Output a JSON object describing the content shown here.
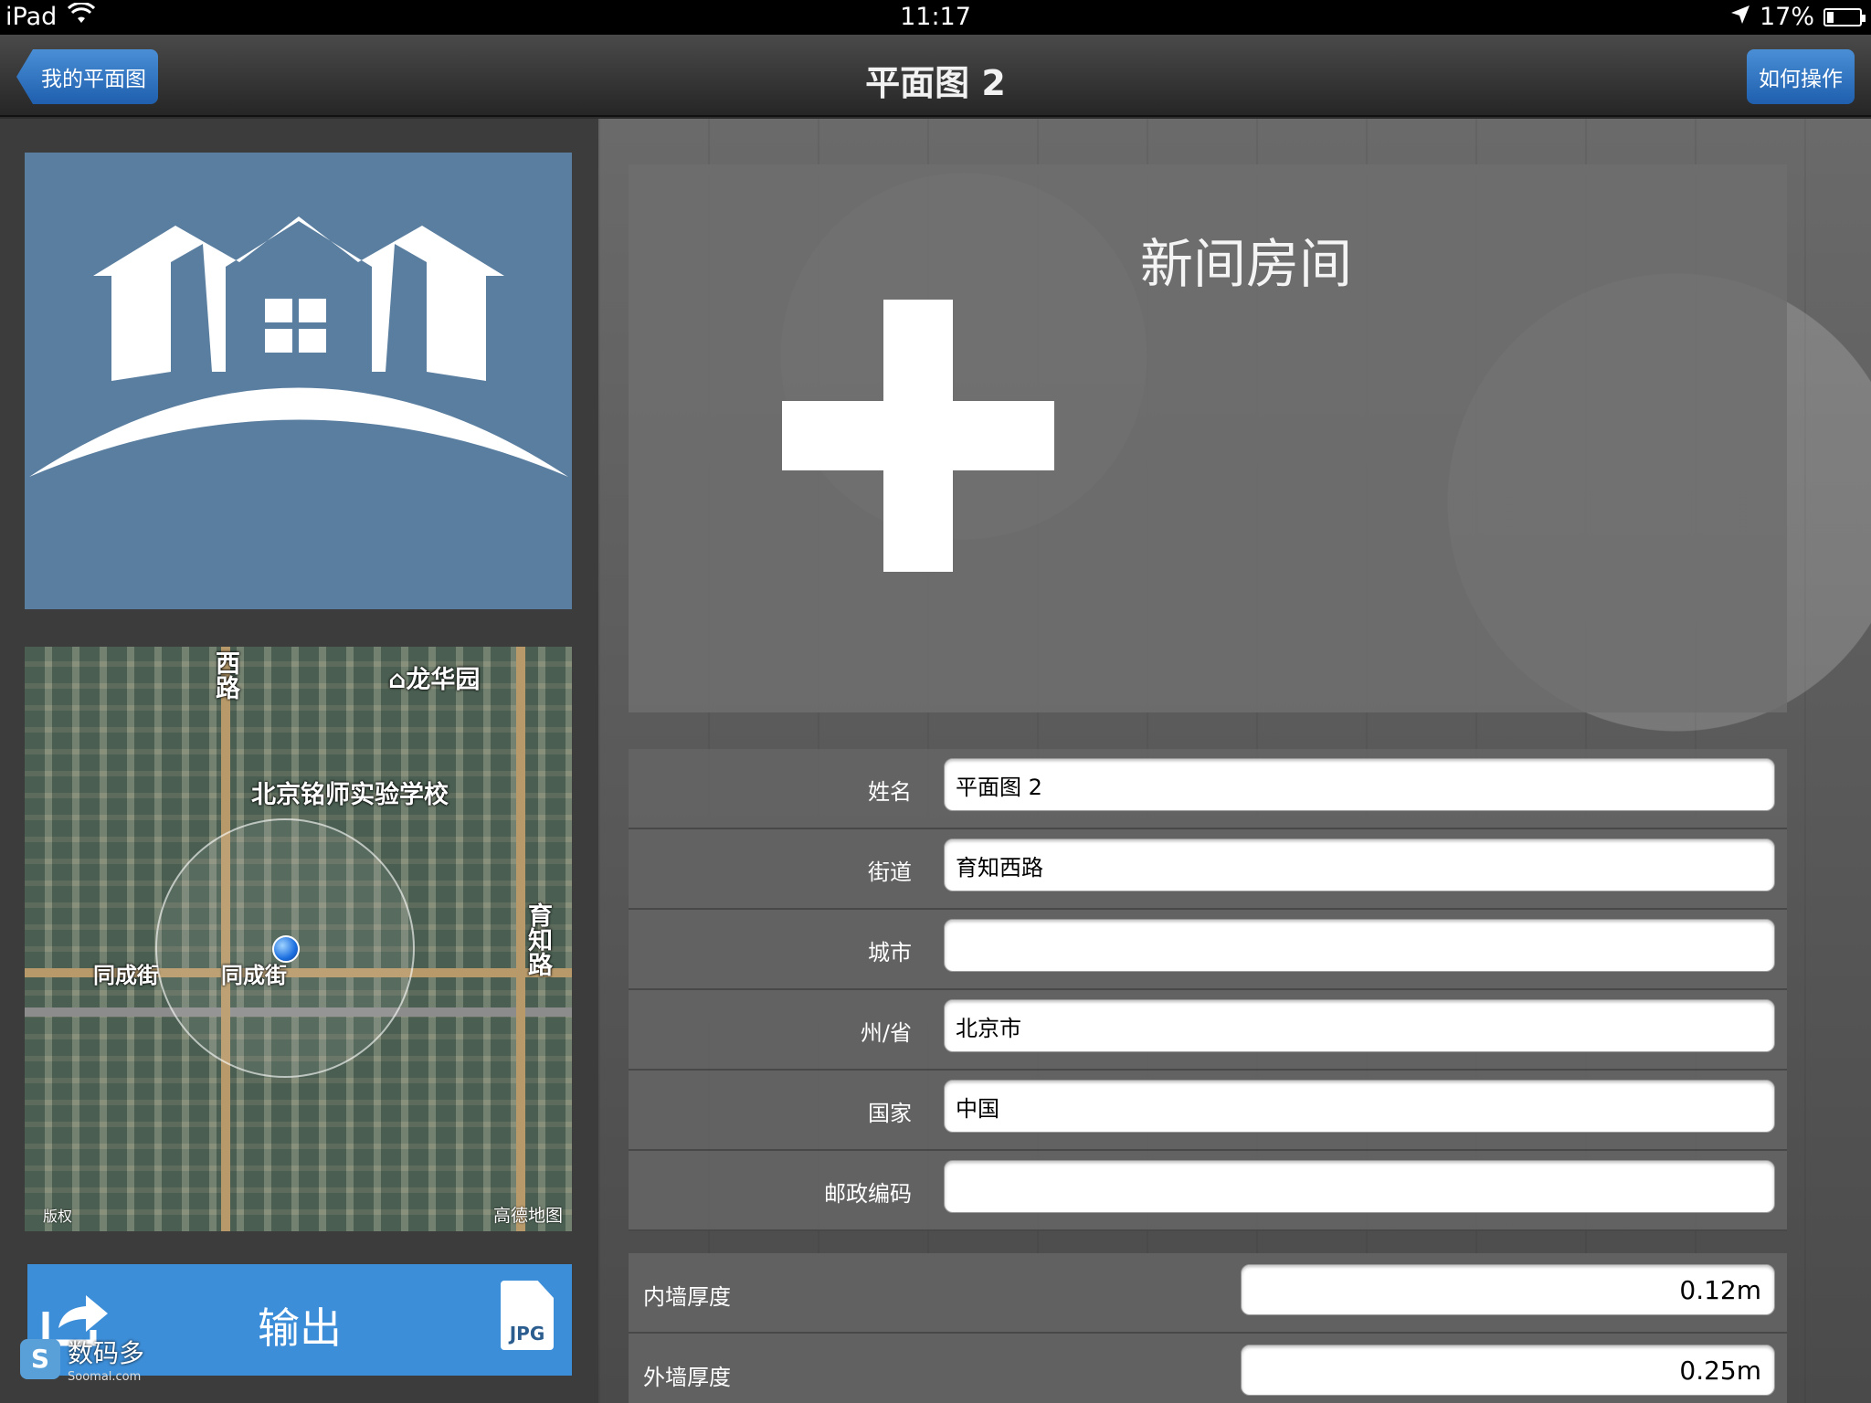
{
  "status_bar": {
    "device": "iPad",
    "time": "11:17",
    "battery": "17%",
    "battery_level": 0.17
  },
  "nav": {
    "back_label": "我的平面图",
    "title": "平面图 2",
    "help_label": "如何操作",
    "accent": "#2f78c8"
  },
  "map": {
    "poi_top": "龙华园",
    "school": "北京铭师实验学校",
    "road_left": "同成街",
    "road_center": "同成街",
    "road_top": "西路",
    "road_right": "育知路",
    "provider": "高德地图",
    "copyright": "版权"
  },
  "export": {
    "label": "输出",
    "format": "JPG"
  },
  "watermark": {
    "logo": "S",
    "text": "数码多",
    "sub": "Soomal.com"
  },
  "new_room": {
    "title": "新间房间"
  },
  "form": [
    {
      "label": "姓名",
      "value": "平面图 2"
    },
    {
      "label": "街道",
      "value": "育知西路"
    },
    {
      "label": "城市",
      "value": ""
    },
    {
      "label": "州/省",
      "value": "北京市"
    },
    {
      "label": "国家",
      "value": "中国"
    },
    {
      "label": "邮政编码",
      "value": ""
    }
  ],
  "walls": [
    {
      "label": "内墙厚度",
      "value": "0.12m"
    },
    {
      "label": "外墙厚度",
      "value": "0.25m"
    }
  ]
}
